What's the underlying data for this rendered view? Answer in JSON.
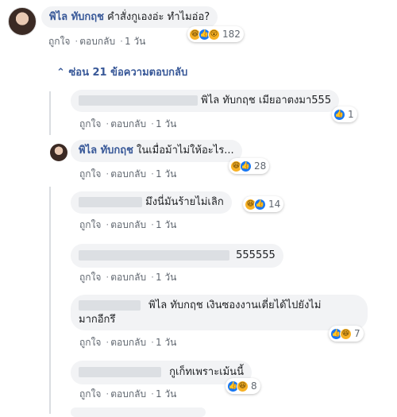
{
  "main_comment": {
    "author": "พิไล ทับกฤช",
    "text": "คำสั่งกูเองอ่ะ ทำไมอ่อ?",
    "like": "ถูกใจ",
    "reply": "ตอบกลับ",
    "time": "1 วัน",
    "reaction_count": "182",
    "reaction_icons": [
      "haha-icon",
      "like-icon",
      "wow-icon"
    ]
  },
  "hide_replies": "ซ่อน 21 ข้อความตอบกลับ",
  "replies": [
    {
      "author": "พิไล ทับกฤช",
      "text": "เมียอาตงมา555",
      "like": "ถูกใจ",
      "reply": "ตอบกลับ",
      "time": "1 วัน",
      "reaction_count": "1"
    },
    {
      "author": "พิไล ทับกฤช",
      "text": "ในเมื่อม้าไม่ให้อะไร...",
      "like": "ถูกใจ",
      "reply": "ตอบกลับ",
      "time": "1 วัน",
      "reaction_count": "28"
    },
    {
      "text": "มึงนี่มันร้ายไม่เลิก",
      "like": "ถูกใจ",
      "reply": "ตอบกลับ",
      "time": "1 วัน",
      "reaction_count": "14"
    },
    {
      "text": "555555",
      "like": "ถูกใจ",
      "reply": "ตอบกลับ",
      "time": "1 วัน"
    },
    {
      "text_line1": "พิไล ทับกฤช เงินซองงานเตี่ยได้ไปยังไม่",
      "text_line2": "มากอีกรึ",
      "like": "ถูกใจ",
      "reply": "ตอบกลับ",
      "time": "1 วัน",
      "reaction_count": "7"
    },
    {
      "text": "กูเก็ทเพราะเม้นนี้",
      "like": "ถูกใจ",
      "reply": "ตอบกลับ",
      "time": "1 วัน",
      "reaction_count": "8"
    }
  ]
}
